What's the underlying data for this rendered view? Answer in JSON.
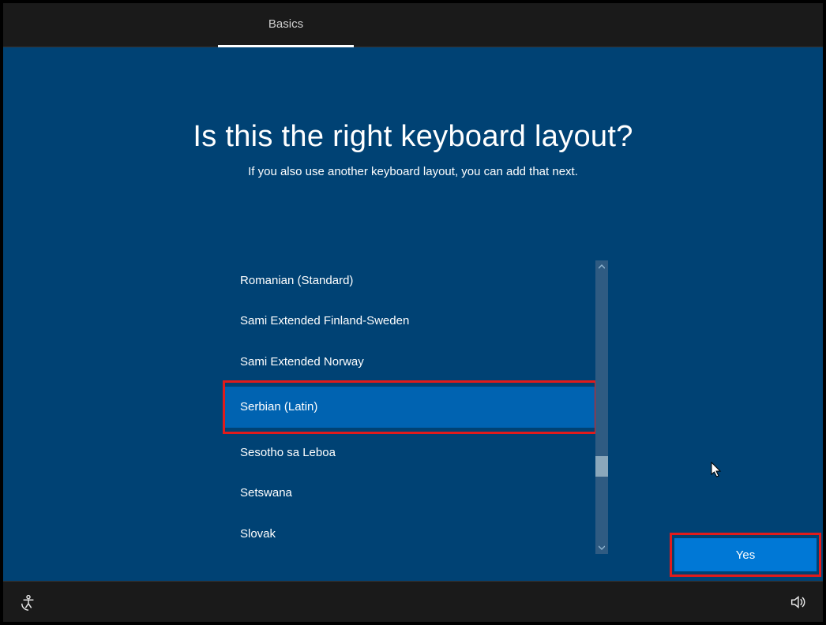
{
  "tabs": {
    "active": "Basics"
  },
  "heading": "Is this the right keyboard layout?",
  "subheading": "If you also use another keyboard layout, you can add that next.",
  "keyboard_list": {
    "items": [
      "Romanian (Standard)",
      "Sami Extended Finland-Sweden",
      "Sami Extended Norway",
      "Serbian (Latin)",
      "Sesotho sa Leboa",
      "Setswana",
      "Slovak"
    ],
    "selected_index": 3
  },
  "buttons": {
    "yes": "Yes"
  },
  "annotations": {
    "highlight_selected_row": true,
    "highlight_yes_button": true
  },
  "icons": {
    "accessibility": "ease-of-access",
    "volume": "volume"
  }
}
